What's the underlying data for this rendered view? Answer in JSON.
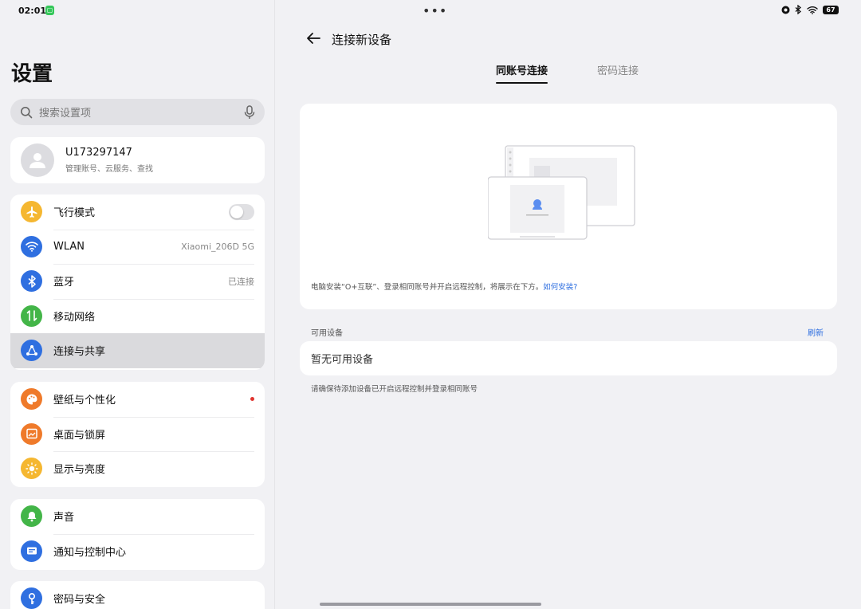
{
  "status_bar": {
    "time": "02:01",
    "notif_icon": "wechat-icon",
    "battery": "67"
  },
  "settings": {
    "title": "设置",
    "search_placeholder": "搜索设置项",
    "account": {
      "name": "U173297147",
      "subtitle": "管理账号、云服务、查找"
    },
    "group1": [
      {
        "label": "飞行模式",
        "icon": "airplane-icon",
        "color": "#f5b731",
        "type": "toggle",
        "on": false
      },
      {
        "label": "WLAN",
        "icon": "wifi-icon",
        "color": "#2f6fe0",
        "value": "Xiaomi_206D 5G"
      },
      {
        "label": "蓝牙",
        "icon": "bluetooth-icon",
        "color": "#2f6fe0",
        "value": "已连接"
      },
      {
        "label": "移动网络",
        "icon": "mobile-data-icon",
        "color": "#43b548"
      },
      {
        "label": "连接与共享",
        "icon": "share-icon",
        "color": "#2f6fe0",
        "selected": true
      }
    ],
    "group2": [
      {
        "label": "壁纸与个性化",
        "icon": "palette-icon",
        "color": "#ef7a2a",
        "badge": true
      },
      {
        "label": "桌面与锁屏",
        "icon": "desktop-icon",
        "color": "#ef7a2a"
      },
      {
        "label": "显示与亮度",
        "icon": "brightness-icon",
        "color": "#f5b731"
      }
    ],
    "group3": [
      {
        "label": "声音",
        "icon": "bell-icon",
        "color": "#43b548"
      },
      {
        "label": "通知与控制中心",
        "icon": "notification-icon",
        "color": "#2f6fe0"
      }
    ],
    "group4": [
      {
        "label": "密码与安全",
        "icon": "key-icon",
        "color": "#2f6fe0"
      }
    ]
  },
  "connect": {
    "title": "连接新设备",
    "tabs": [
      "同账号连接",
      "密码连接"
    ],
    "active_tab": 0,
    "info_text": "电脑安装“O+互联”、登录相同账号并开启远程控制，将展示在下方。",
    "info_link": "如何安装?",
    "available_label": "可用设备",
    "refresh_label": "刷新",
    "empty_text": "暂无可用设备",
    "hint": "请确保待添加设备已开启远程控制并登录相同账号"
  }
}
